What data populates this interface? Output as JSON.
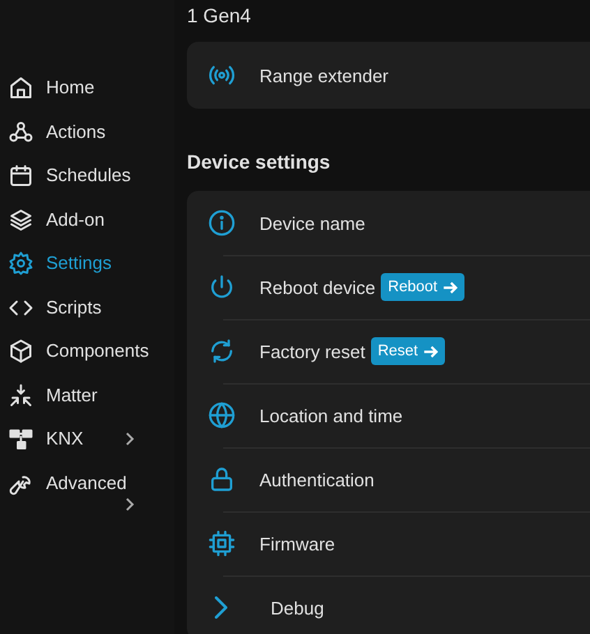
{
  "sidebar": {
    "items": [
      {
        "label": "Home",
        "selected": false,
        "expandable": false
      },
      {
        "label": "Actions",
        "selected": false,
        "expandable": false
      },
      {
        "label": "Schedules",
        "selected": false,
        "expandable": false
      },
      {
        "label": "Add-on",
        "selected": false,
        "expandable": false
      },
      {
        "label": "Settings",
        "selected": true,
        "expandable": false
      },
      {
        "label": "Scripts",
        "selected": false,
        "expandable": false
      },
      {
        "label": "Components",
        "selected": false,
        "expandable": false
      },
      {
        "label": "Matter",
        "selected": false,
        "expandable": false
      },
      {
        "label": "KNX",
        "selected": false,
        "expandable": true
      },
      {
        "label": "Advanced",
        "selected": false,
        "expandable": true
      }
    ]
  },
  "main": {
    "device_title": "1 Gen4",
    "top_card": {
      "rows": [
        {
          "label": "Range extender"
        }
      ]
    },
    "section_title": "Device settings",
    "settings_card": {
      "rows": [
        {
          "label": "Device name"
        },
        {
          "label": "Reboot device",
          "action": "Reboot"
        },
        {
          "label": "Factory reset",
          "action": "Reset"
        },
        {
          "label": "Location and time"
        },
        {
          "label": "Authentication"
        },
        {
          "label": "Firmware"
        },
        {
          "label": "Debug"
        }
      ]
    }
  }
}
